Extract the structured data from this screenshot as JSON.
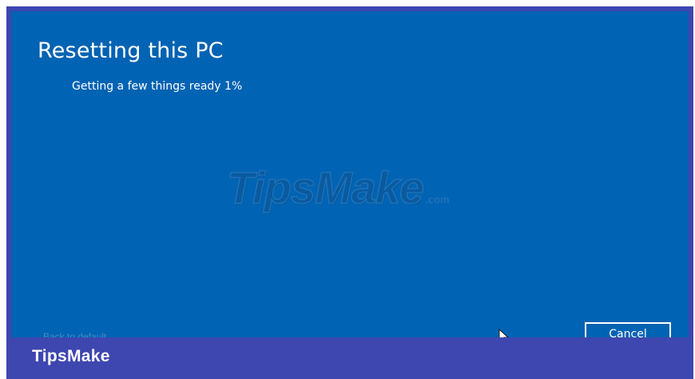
{
  "window": {
    "title": "Resetting this PC",
    "status": "Getting a few things ready 1%",
    "progress_percent": 1
  },
  "buttons": {
    "cancel_label": "Cancel"
  },
  "footer": {
    "faded_text": "Back to default"
  },
  "watermark": {
    "main": "TipsMake",
    "sub": ".com"
  },
  "banner": {
    "label": "TipsMake"
  },
  "colors": {
    "screen_background": "#0063b3",
    "border": "#3e46b0",
    "text": "#ffffff"
  }
}
